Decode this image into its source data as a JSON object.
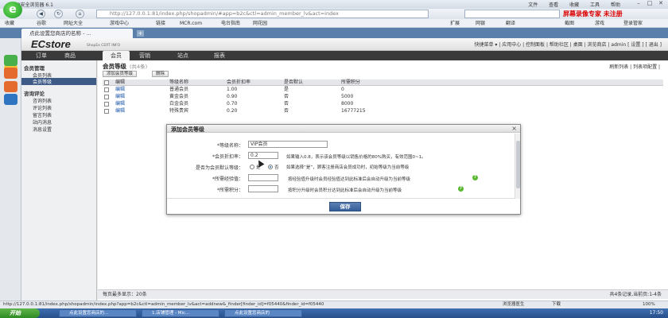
{
  "browser": {
    "title": "360安全浏览器 6.1",
    "menu": [
      "文件",
      "查看",
      "收藏",
      "工具",
      "帮助"
    ],
    "url": "http://127.0.0.1:81/index.php/shopadmin/#app=b2c&ctl=admin_member_lv&act=index",
    "badge": "屏幕录像专家 未注册",
    "favorites": [
      "收藏",
      "谷歌",
      "网址大全",
      "游戏中心",
      "链接",
      "MCR.com",
      "电台指南",
      "网花园"
    ],
    "fav_right": [
      "扩展",
      "网银",
      "翻译",
      "截图",
      "游戏",
      "登录管家"
    ],
    "tab_label": "点此设置您商店的名称 - ...",
    "new_tab": "+"
  },
  "admin": {
    "brand": "ECstore",
    "brand_sub": "ShopEx CERT INFO",
    "toplinks": "快捷菜单 ▾ | 应用中心 | 控制面板 | 帮助社区 | 桌面 | 浏览商店 | admin [ 设置 ] [ 退出 ]",
    "nav": [
      "订单",
      "商品",
      "会员",
      "营销",
      "站点",
      "报表"
    ],
    "active_nav": 2,
    "sidebar": {
      "groups": [
        {
          "title": "会员管理",
          "items": [
            "会员列表",
            "会员等级"
          ]
        },
        {
          "title": "咨询评论",
          "items": [
            "咨询列表",
            "评论列表",
            "留言列表",
            "站内消息",
            "消息设置"
          ]
        }
      ],
      "selected": "会员等级"
    },
    "content": {
      "title": "会员等级",
      "count": "(共4条)",
      "right_links": "刷新列表 | 列表项配置 |",
      "buttons": [
        "添加会员等级",
        "删除"
      ],
      "columns": [
        "编辑",
        "等级名称",
        "会员折扣率",
        "是否默认",
        "所需积分"
      ],
      "rows": [
        {
          "edit": "编辑",
          "name": "普通会员",
          "rate": "1.00",
          "default": "是",
          "points": "0"
        },
        {
          "edit": "编辑",
          "name": "黄金会员",
          "rate": "0.90",
          "default": "否",
          "points": "5000"
        },
        {
          "edit": "编辑",
          "name": "白金会员",
          "rate": "0.70",
          "default": "否",
          "points": "8000"
        },
        {
          "edit": "编辑",
          "name": "特殊贵宾",
          "rate": "0.20",
          "default": "否",
          "points": "16777215"
        }
      ],
      "footer_left": "每页最多显示：20条",
      "footer_right": "共4条记录,当前页:1-4条"
    }
  },
  "modal": {
    "title": "添加会员等级",
    "close": "×",
    "fields": [
      {
        "label": "*等级名称：",
        "value": "VIP会员"
      },
      {
        "label": "*会员折扣率：",
        "value": "0.2",
        "hint": "如果输入0.8，表示该会员等级以销售价格的80%购买，有效范围0~1。"
      },
      {
        "label": "是否为会员默认等级：",
        "options": [
          "是",
          "否"
        ],
        "selected": "否",
        "hint": "如果选择“是”，顾客注册商店会员成功时，初始等级为当前等级"
      },
      {
        "label": "*所需经验值：",
        "value": "",
        "hint": "按经验值升级时会员经验值达到此标准后会自动升级为当前等级"
      },
      {
        "label": "*所需积分：",
        "value": "",
        "hint": "按积分升级时会员积分达到此标准后会自动升级为当前等级"
      }
    ],
    "save": "保存"
  },
  "status": {
    "url": "http://127.0.0.1:81/index.php/shopadmin/index.php?app=b2c&ctl=admin_member_lv&act=addnew&_finder[finder_id]=f05440&finder_id=f05440",
    "right": [
      "浏览器医生",
      "下载",
      "100%"
    ]
  },
  "taskbar": {
    "start": "开始",
    "tasks": [
      "点此设置您商店的...",
      "1.店铺管理 - Mic...",
      "点此设置您商店的"
    ],
    "clock": "17:50"
  },
  "colors": {
    "accent": "#3d5b86",
    "save": "#345e98",
    "hint_icon": "#5ab830",
    "badge": "#dd0000"
  }
}
